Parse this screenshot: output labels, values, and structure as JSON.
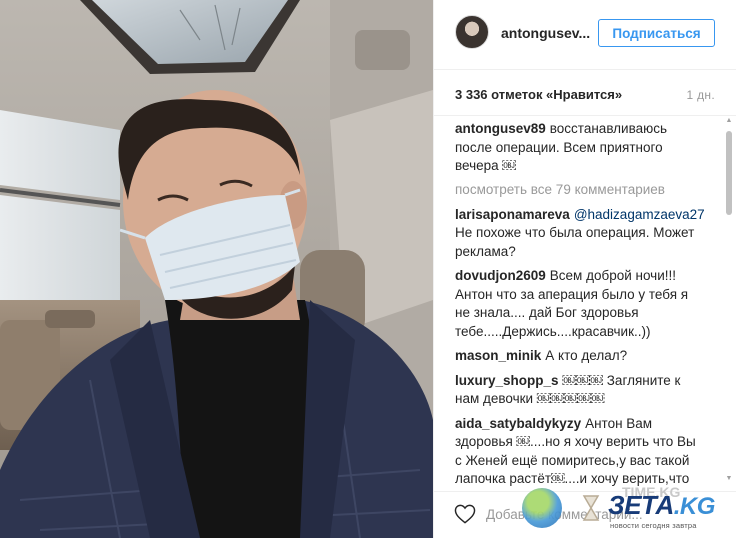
{
  "post": {
    "username": "antongusev...",
    "follow_label": "Подписаться",
    "likes": "3 336 отметок «Нравится»",
    "age": "1 дн.",
    "caption": {
      "author": "antongusev89",
      "text": "восстанавливаюсь после операции. Всем приятного вечера ￼"
    },
    "view_all_comments": "посмотреть все 79 комментариев",
    "comments": [
      {
        "author": "larisaponamareva",
        "mention": "@hadizagamzaeva27",
        "text": " Не похоже что была операция. Может реклама?"
      },
      {
        "author": "dovudjon2609",
        "mention": "",
        "text": "Всем доброй ночи!!! Антон что за аперация было у тебя я не знала.... дай Бог здоровья тебе.....Держись....красавчик..))"
      },
      {
        "author": "mason_minik",
        "mention": "",
        "text": "А кто делал?"
      },
      {
        "author": "luxury_shopp_s",
        "mention": "",
        "text": "￼￼￼ Загляните к нам девочки ￼￼￼￼￼"
      },
      {
        "author": "aida_satybaldykyzy",
        "mention": "",
        "text": "Антон Вам здоровья ￼....но я хочу верить что Вы с Женей ещё помиритесь,у вас такой лапочка растёт￼....и хочу верить,что Вы ни с Викой,что может привлечь вообще￼в ней￼￼￼...блииин.ну что все"
      }
    ],
    "comment_placeholder": "Добавьте комментарий..."
  },
  "watermark": {
    "brand_main": "ЗЕТА",
    "brand_suffix": ".KG",
    "ghost": "TIME.KG",
    "tagline": "новости сегодня завтра"
  },
  "icons": {
    "heart": "heart-outline-icon",
    "scroll_up": "scroll-up-arrow-icon",
    "scroll_down": "scroll-down-arrow-icon"
  },
  "colors": {
    "link_blue": "#3897f0",
    "mention_blue": "#003569",
    "muted": "#999999",
    "border": "#efefef"
  }
}
